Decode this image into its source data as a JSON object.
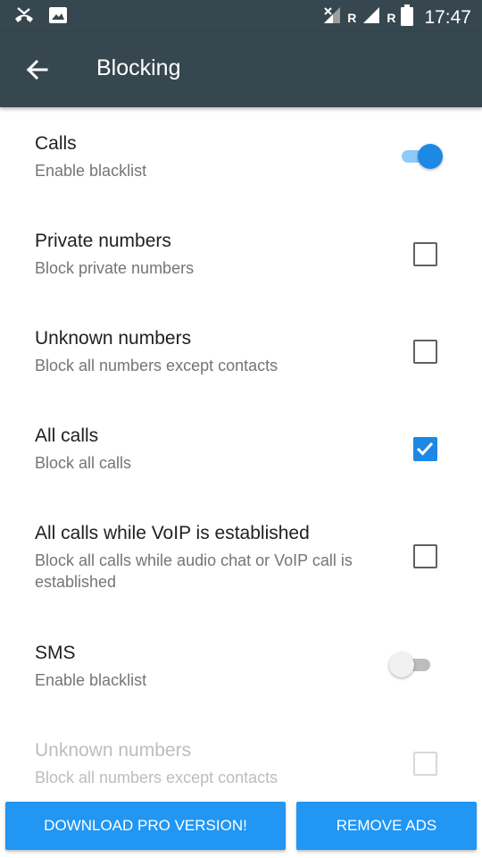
{
  "status_bar": {
    "time": "17:47",
    "network_label_1": "R",
    "network_label_2": "R",
    "icons": [
      "missed-call-icon",
      "image-icon",
      "signal-icon",
      "signal-icon",
      "battery-icon"
    ]
  },
  "toolbar": {
    "title": "Blocking",
    "back_icon": "arrow-back-icon"
  },
  "settings": [
    {
      "title": "Calls",
      "summary": "Enable blacklist",
      "control": "switch",
      "checked": true,
      "enabled": true
    },
    {
      "title": "Private numbers",
      "summary": "Block private numbers",
      "control": "checkbox",
      "checked": false,
      "enabled": true
    },
    {
      "title": "Unknown numbers",
      "summary": "Block all numbers except contacts",
      "control": "checkbox",
      "checked": false,
      "enabled": true
    },
    {
      "title": "All calls",
      "summary": "Block all calls",
      "control": "checkbox",
      "checked": true,
      "enabled": true
    },
    {
      "title": "All calls while VoIP is established",
      "summary": "Block all calls while audio chat or VoIP call is established",
      "control": "checkbox",
      "checked": false,
      "enabled": true
    },
    {
      "title": "SMS",
      "summary": "Enable blacklist",
      "control": "switch",
      "checked": false,
      "enabled": true
    },
    {
      "title": "Unknown numbers",
      "summary": "Block all numbers except contacts",
      "control": "checkbox",
      "checked": false,
      "enabled": false
    }
  ],
  "buttons": {
    "download_pro": "DOWNLOAD PRO VERSION!",
    "remove_ads": "REMOVE ADS"
  },
  "colors": {
    "toolbar": "#37474f",
    "accent": "#1e88e5",
    "button": "#2196f3"
  }
}
